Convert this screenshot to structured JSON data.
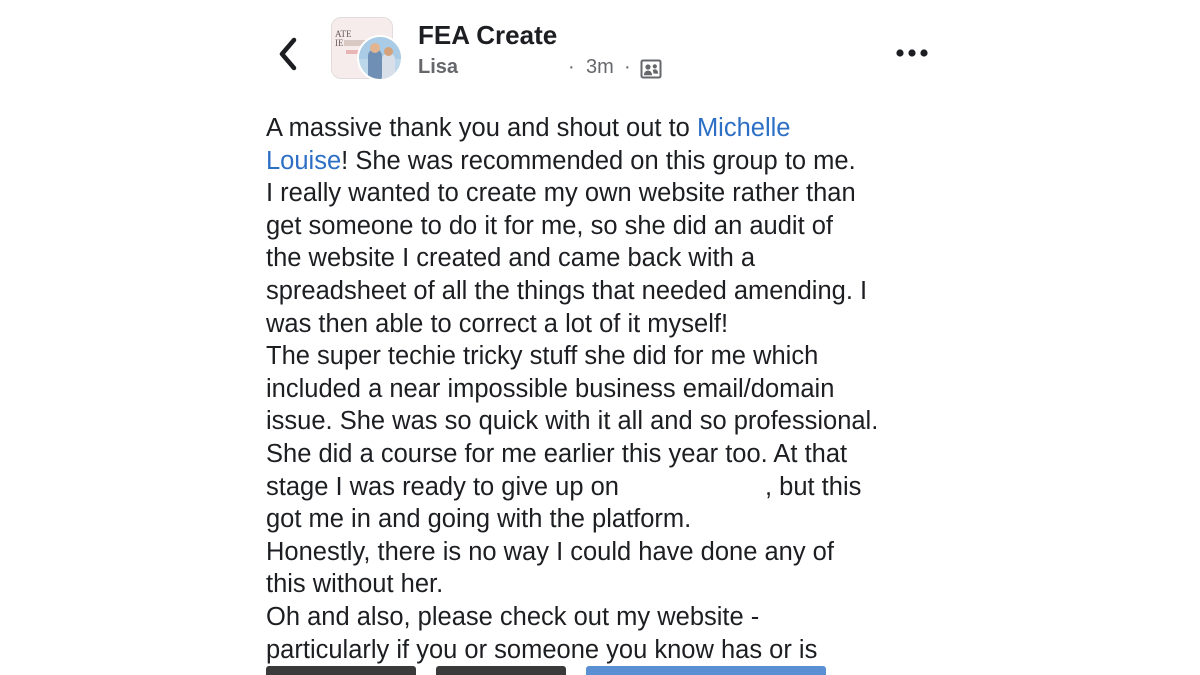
{
  "header": {
    "group_name": "FEA Create",
    "author": "Lisa",
    "separator": "·",
    "time": "3m",
    "avatar_poster_text": "ATE\nIE"
  },
  "icons": {
    "back": "chevron-left-icon",
    "privacy": "group-members-icon",
    "more": "ellipsis-icon"
  },
  "post": {
    "lines": [
      {
        "before": "A massive thank you and shout out to ",
        "mention": "Michelle",
        "after": ""
      },
      {
        "before": "",
        "mention": "Louise",
        "after": "! She was recommended on this group to me."
      },
      {
        "before": "I really wanted to create my own website rather than",
        "mention": "",
        "after": ""
      },
      {
        "before": "get someone to do it for me, so she did an audit of",
        "mention": "",
        "after": ""
      },
      {
        "before": "the website I created and came back with a",
        "mention": "",
        "after": ""
      },
      {
        "before": "spreadsheet of all the things that needed amending. I",
        "mention": "",
        "after": ""
      },
      {
        "before": "was then able to correct a lot of it myself!",
        "mention": "",
        "after": ""
      },
      {
        "before": "The super techie tricky stuff she did for me which",
        "mention": "",
        "after": ""
      },
      {
        "before": "included a near impossible business email/domain",
        "mention": "",
        "after": ""
      },
      {
        "before": "issue. She was so quick with it all and so professional.",
        "mention": "",
        "after": ""
      },
      {
        "before": "She did a course for me earlier this year too. At that",
        "mention": "",
        "after": ""
      },
      {
        "before": "stage I was ready to give up on",
        "redacted": true,
        "after": ", but this"
      },
      {
        "before": "got me in and going with the platform.",
        "mention": "",
        "after": ""
      },
      {
        "before": "Honestly, there is no way I could have done any of",
        "mention": "",
        "after": ""
      },
      {
        "before": "this without her.",
        "mention": "",
        "after": ""
      },
      {
        "before": "Oh and also, please check out my website -",
        "mention": "",
        "after": ""
      },
      {
        "before": "particularly if you or someone you know has or is",
        "mention": "",
        "after": ""
      }
    ]
  },
  "colors": {
    "text": "#1c1e21",
    "secondary": "#65676b",
    "link": "#2d6fc4",
    "background": "#ffffff"
  }
}
